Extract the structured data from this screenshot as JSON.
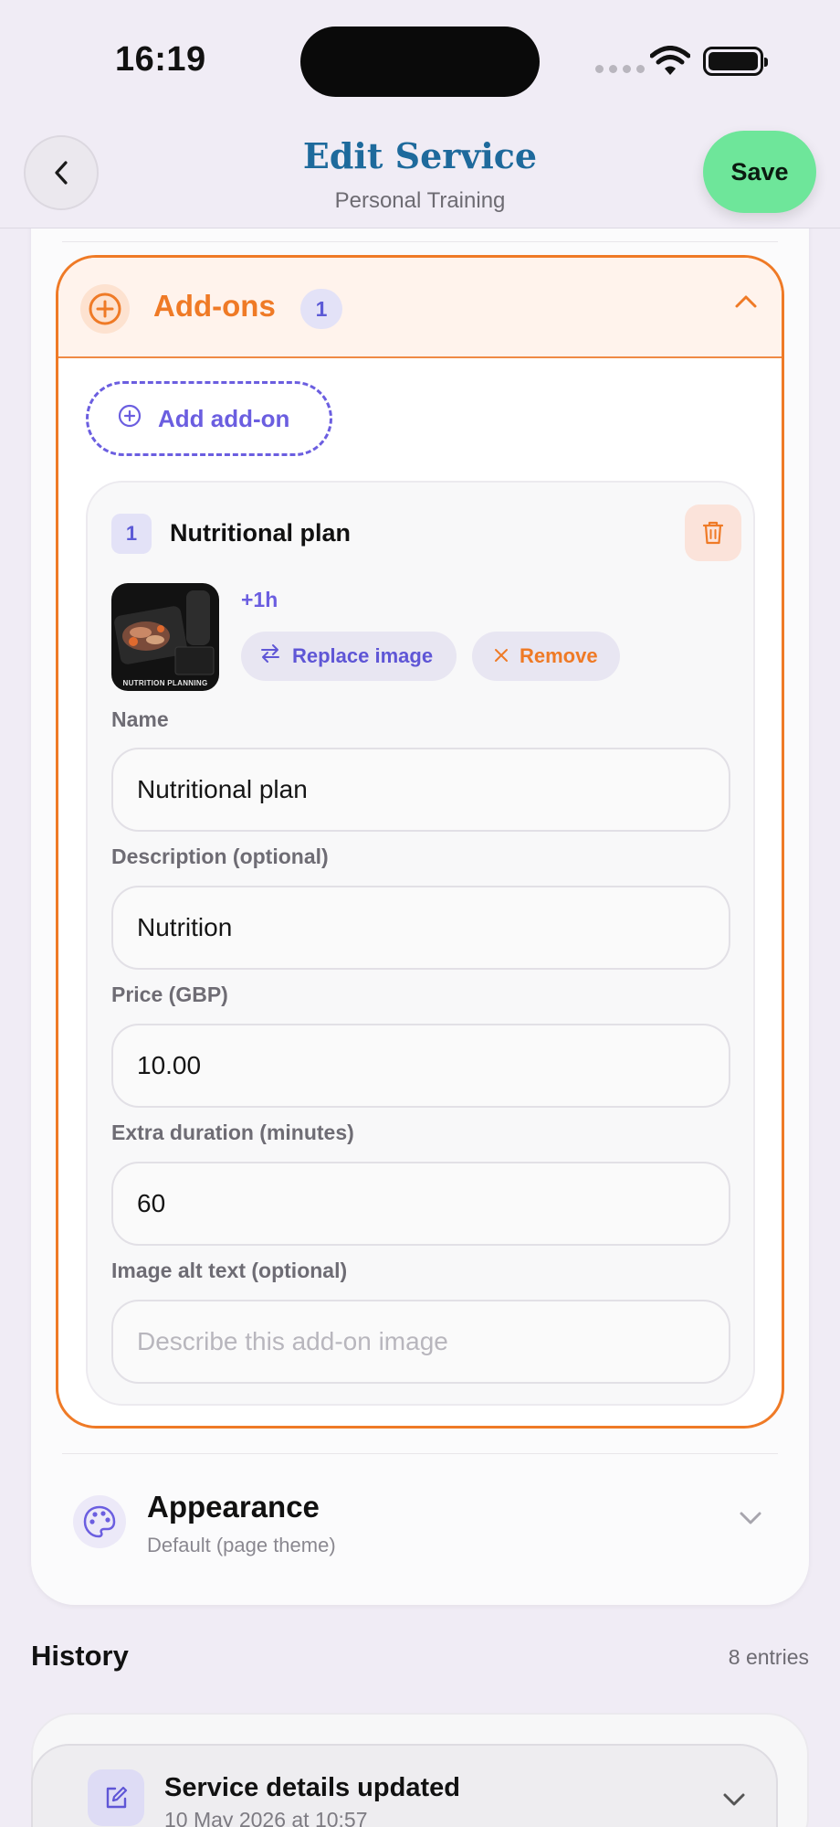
{
  "status_bar": {
    "time": "16:19"
  },
  "header": {
    "title": "Edit Service",
    "subtitle": "Personal Training",
    "save_label": "Save"
  },
  "addons": {
    "title": "Add-ons",
    "count": "1",
    "add_button_label": "Add add-on",
    "items": [
      {
        "index": "1",
        "name_heading": "Nutritional plan",
        "image_caption": "NUTRITION PLANNING",
        "duration_tag": "+1h",
        "replace_label": "Replace image",
        "remove_label": "Remove",
        "fields": {
          "name": {
            "label": "Name",
            "value": "Nutritional plan"
          },
          "description": {
            "label": "Description (optional)",
            "value": "Nutrition"
          },
          "price": {
            "label": "Price (GBP)",
            "value": "10.00"
          },
          "duration": {
            "label": "Extra duration (minutes)",
            "value": "60"
          },
          "alt_text": {
            "label": "Image alt text (optional)",
            "value": "",
            "placeholder": "Describe this add-on image"
          }
        }
      }
    ]
  },
  "appearance": {
    "title": "Appearance",
    "subtitle": "Default (page theme)"
  },
  "history": {
    "title": "History",
    "count": "8 entries",
    "entries": [
      {
        "title": "Service details updated",
        "date": "10 May 2026 at 10:57"
      }
    ]
  },
  "colors": {
    "accent_orange": "#ef7a26",
    "accent_purple": "#6b5ee0",
    "title_blue": "#1e6a9c",
    "save_green": "#6ee69a"
  }
}
